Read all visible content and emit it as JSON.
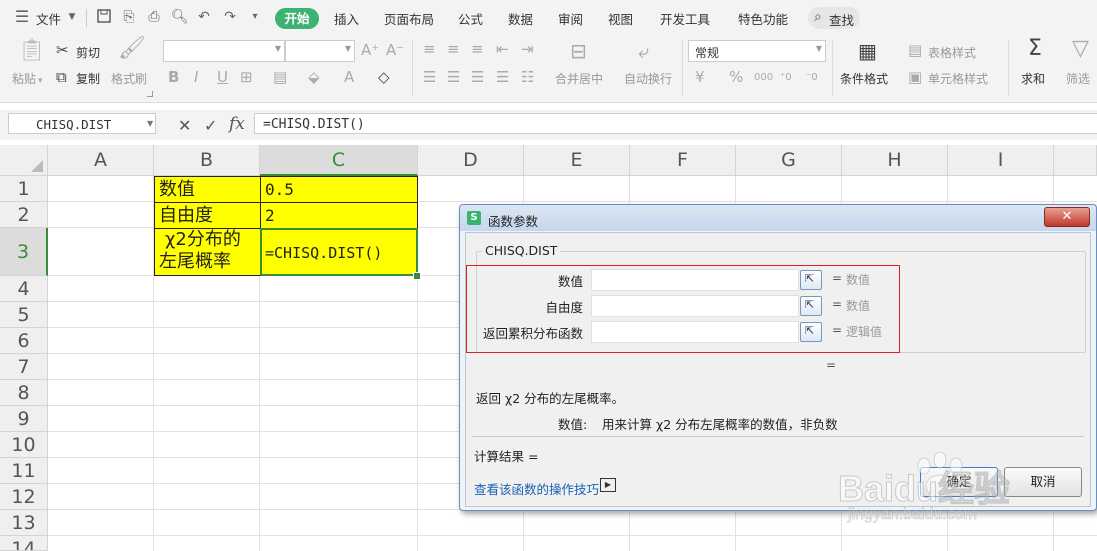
{
  "menubar": {
    "file_label": "文件",
    "tabs": [
      "开始",
      "插入",
      "页面布局",
      "公式",
      "数据",
      "审阅",
      "视图",
      "开发工具",
      "特色功能"
    ],
    "search_label": "查找"
  },
  "ribbon": {
    "paste": "粘贴",
    "cut": "剪切",
    "copy": "复制",
    "format_painter": "格式刷",
    "merge_center": "合并居中",
    "wrap_text": "自动换行",
    "number_format": "常规",
    "conditional_format": "条件格式",
    "table_style": "表格样式",
    "cell_style": "单元格样式",
    "sum": "求和",
    "filter": "筛选"
  },
  "formulabar": {
    "name_box": "CHISQ.DIST",
    "fx": "fx",
    "formula": "=CHISQ.DIST()"
  },
  "sheet": {
    "columns": [
      "A",
      "B",
      "C",
      "D",
      "E",
      "F",
      "G",
      "H",
      "I"
    ],
    "rows": [
      "1",
      "2",
      "3",
      "4",
      "5",
      "6",
      "7",
      "8",
      "9",
      "10",
      "11",
      "12",
      "13",
      "14"
    ],
    "b1": "数值",
    "c1": "0.5",
    "b2": "自由度",
    "c2": "2",
    "b3_line1": "χ2分布的",
    "b3_line2": "左尾概率",
    "c3": "=CHISQ.DIST()"
  },
  "dialog": {
    "title": "函数参数",
    "function_name": "CHISQ.DIST",
    "args": [
      {
        "label": "数值",
        "type": "数值"
      },
      {
        "label": "自由度",
        "type": "数值"
      },
      {
        "label": "返回累积分布函数",
        "type": "逻辑值"
      }
    ],
    "equals": "=",
    "result_equals": "=",
    "description": "返回 χ2 分布的左尾概率。",
    "arg_help_name": "数值:",
    "arg_help_text": "用来计算 χ2 分布左尾概率的数值，非负数",
    "calc_result_label": "计算结果 =",
    "help_link": "查看该函数的操作技巧",
    "ok_button": "确定",
    "cancel_button": "取消"
  },
  "watermark": {
    "brand": "Baidu经验",
    "url": "jingyan.baidu.com"
  },
  "colors": {
    "accent": "#3cb371",
    "highlight": "#ffff00",
    "selection": "#3a8a3a",
    "annotation": "#e02020"
  }
}
